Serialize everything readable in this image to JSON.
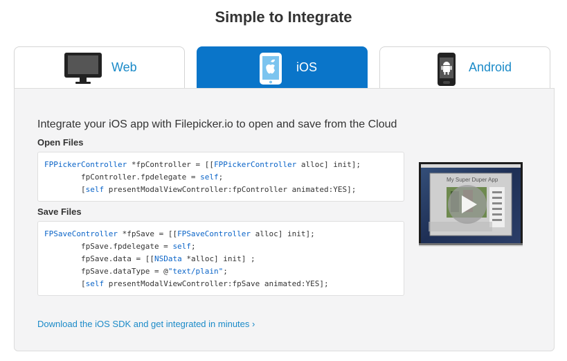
{
  "page": {
    "title": "Simple to Integrate"
  },
  "tabs": [
    {
      "label": "Web",
      "icon": "monitor-icon"
    },
    {
      "label": "iOS",
      "icon": "apple-tablet-icon"
    },
    {
      "label": "Android",
      "icon": "android-phone-icon"
    }
  ],
  "colors": {
    "accent": "#0a75c9",
    "link": "#1a8ac8",
    "panel_bg": "#f4f4f5",
    "code_keyword": "#0a64c8"
  },
  "panel": {
    "intro": "Integrate your iOS app with Filepicker.io to open and save from the Cloud",
    "open_files": {
      "heading": "Open Files",
      "lines": [
        [
          {
            "t": "FPPickerController",
            "k": 1
          },
          {
            "t": " *fpController = [["
          },
          {
            "t": "FPPickerController",
            "k": 1
          },
          {
            "t": " alloc] init];"
          }
        ],
        [
          {
            "t": "        fpController.fpdelegate = "
          },
          {
            "t": "self",
            "k": 1
          },
          {
            "t": ";"
          }
        ],
        [
          {
            "t": "        ["
          },
          {
            "t": "self",
            "k": 1
          },
          {
            "t": " presentModalViewController:fpController animated:YES];"
          }
        ]
      ]
    },
    "save_files": {
      "heading": "Save Files",
      "lines": [
        [
          {
            "t": "FPSaveController",
            "k": 1
          },
          {
            "t": " *fpSave = [["
          },
          {
            "t": "FPSaveController",
            "k": 1
          },
          {
            "t": " alloc] init];"
          }
        ],
        [
          {
            "t": "        fpSave.fpdelegate = "
          },
          {
            "t": "self",
            "k": 1
          },
          {
            "t": ";"
          }
        ],
        [
          {
            "t": "        fpSave.data = [["
          },
          {
            "t": "NSData",
            "k": 1
          },
          {
            "t": " *alloc] init] ;"
          }
        ],
        [
          {
            "t": "        fpSave.dataType = @"
          },
          {
            "t": "\"text/plain\"",
            "k": 1
          },
          {
            "t": ";"
          }
        ],
        [
          {
            "t": "        ["
          },
          {
            "t": "self",
            "k": 1
          },
          {
            "t": " presentModalViewController:fpSave animated:YES];"
          }
        ]
      ]
    },
    "download_link": "Download the iOS SDK and get integrated in minutes ›",
    "video": {
      "screen_title": "My Super Duper App",
      "icon": "play-icon"
    }
  }
}
